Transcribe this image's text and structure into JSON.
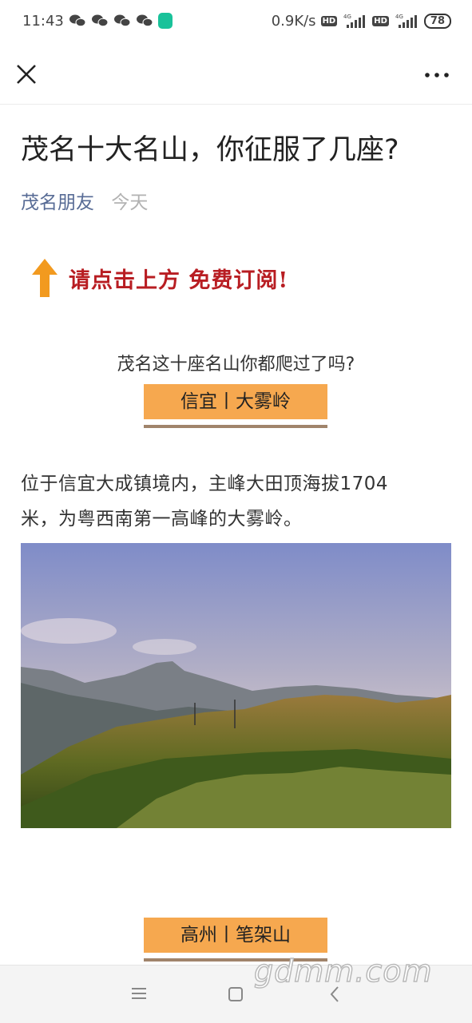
{
  "status_bar": {
    "time": "11:43",
    "net_speed": "0.9K/s",
    "hd1": "HD",
    "hd2": "HD",
    "signal1_label": "4G",
    "signal2_label": "4G",
    "battery": "78",
    "notification_icons": [
      "wechat-icon",
      "wechat-icon",
      "wechat-icon",
      "wechat-icon",
      "app-icon"
    ]
  },
  "top_bar": {
    "close_icon": "close-icon",
    "more_icon": "more-icon"
  },
  "article": {
    "title": "茂名十大名山，你征服了几座?",
    "author": "茂名朋友",
    "date": "今天",
    "subscribe_banner": "请点击上方 免费订阅!",
    "intro": "茂名这十座名山你都爬过了吗?",
    "section1": {
      "tag": "信宜丨大雾岭",
      "paragraph_line1": "位于信宜大成镇境内，主峰大田顶海拔1704",
      "paragraph_line2": "米，为粤西南第一高峰的大雾岭。"
    },
    "section2": {
      "tag": "高州丨笔架山"
    }
  },
  "watermark": "gdmm.com",
  "colors": {
    "tag_bg": "#f6a84f",
    "tag_underline": "#a0846b",
    "author_link": "#576b95",
    "banner_red": "#b81d22",
    "arrow_orange": "#f29a1f"
  }
}
